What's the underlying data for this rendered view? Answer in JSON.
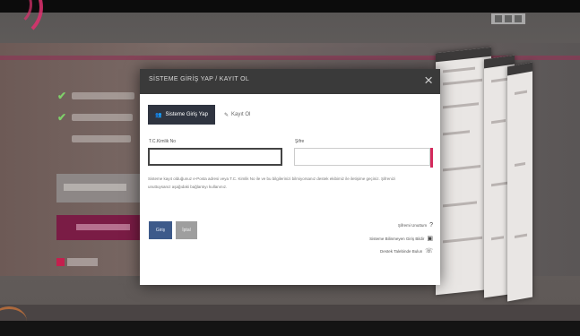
{
  "modal": {
    "title": "SİSTEME GİRİŞ YAP / KAYIT OL",
    "close_symbol": "×",
    "tabs": [
      {
        "label": "Sisteme Giriş Yap",
        "icon": "user-group-icon",
        "active": true
      },
      {
        "label": "Kayıt Ol",
        "icon": "edit-icon",
        "active": false
      }
    ],
    "fields": {
      "tc_label": "T.C.Kimlik No",
      "tc_value": "",
      "password_label": "Şifre",
      "password_value": ""
    },
    "info_text": "Sisteme kayıt olduğunuz e-Posta adresi veya T.C. Kimlik No ile ve bu bilgilerinizi bilmiyorsanız destek ekibimiz ile iletişime geçiniz. Şifrenizi unuttuysanız aşağıdaki bağlantıyı kullanınız.",
    "buttons": {
      "submit": "Giriş",
      "cancel": "İptal"
    },
    "links": [
      {
        "label": "Şifremi Unuttum",
        "icon": "question-icon"
      },
      {
        "label": "Sisteme Bilinmeyen Giriş Bildir",
        "icon": "report-icon"
      },
      {
        "label": "Destek Talebinde Bulun",
        "icon": "support-icon"
      }
    ]
  },
  "background": {
    "features": [
      "KVKK uyumlu veri yönetimi",
      "Verbalarınız ve belgeleriniz",
      "En uygun yazılım çözümü"
    ],
    "trial_button": "Ücretsiz Kayıt Ol",
    "login_button": "Sisteme Giriş Yap",
    "logo": "verbis"
  },
  "colors": {
    "accent": "#d42a5c",
    "modal_header": "#3a3a3a",
    "tab_active": "#2f3440",
    "submit": "#3d5a8a"
  }
}
